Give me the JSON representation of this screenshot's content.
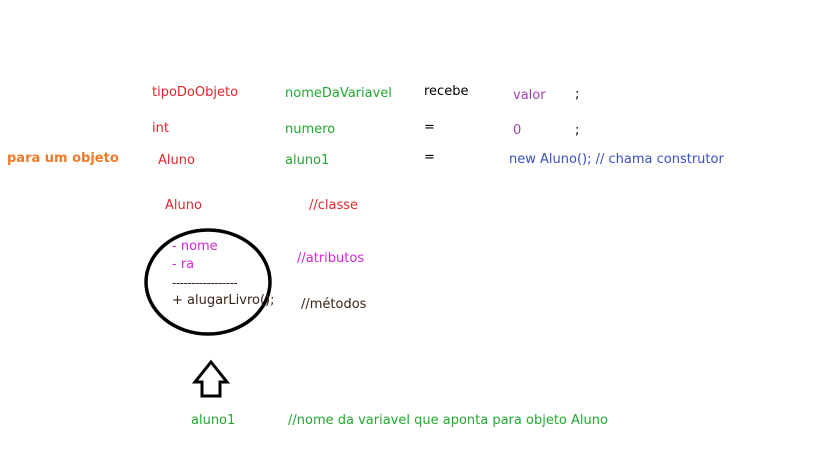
{
  "colors": {
    "red": "#e8252b",
    "green": "#22a830",
    "purple": "#a640b6",
    "blue": "#3a4fc4",
    "orange": "#f07a2a",
    "magenta": "#d428d4",
    "dark": "#3a2418",
    "black": "#000000"
  },
  "syntax_row": {
    "type": "tipoDoObjeto",
    "name": "nomeDaVariavel",
    "assign": "recebe",
    "value": "valor",
    "semicolon": ";"
  },
  "int_row": {
    "type": "int",
    "name": "numero",
    "assign": "=",
    "value": "0",
    "semicolon": ";"
  },
  "object_row": {
    "side_label": "para um objeto",
    "type": "Aluno",
    "name": "aluno1",
    "assign": "=",
    "value": "new Aluno(); // chama construtor"
  },
  "class_box": {
    "class_name": "Aluno",
    "class_comment": "//classe",
    "attr_1": "- nome",
    "attr_2": "- ra",
    "divider": "-----------------",
    "method_1": "+ alugarLivro();",
    "attr_comment": "//atributos",
    "method_comment": "//métodos"
  },
  "reference": {
    "variable": "aluno1",
    "comment": "//nome da variavel que aponta para objeto Aluno"
  },
  "icons": {
    "arrow": "up-arrow-icon",
    "ellipse": "object-ellipse"
  }
}
